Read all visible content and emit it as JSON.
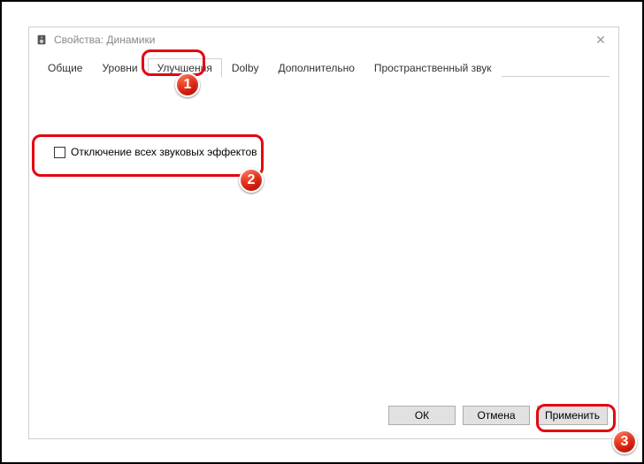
{
  "window": {
    "title": "Свойства: Динамики",
    "icon_name": "speaker-icon"
  },
  "tabs": [
    {
      "label": "Общие",
      "active": false
    },
    {
      "label": "Уровни",
      "active": false
    },
    {
      "label": "Улучшения",
      "active": true
    },
    {
      "label": "Dolby",
      "active": false
    },
    {
      "label": "Дополнительно",
      "active": false
    },
    {
      "label": "Пространственный звук",
      "active": false
    }
  ],
  "content": {
    "disable_effects_label": "Отключение всех звуковых эффектов",
    "disable_effects_checked": false
  },
  "buttons": {
    "ok": "ОК",
    "cancel": "Отмена",
    "apply": "Применить"
  },
  "callouts": {
    "badge1": "1",
    "badge2": "2",
    "badge3": "3"
  }
}
